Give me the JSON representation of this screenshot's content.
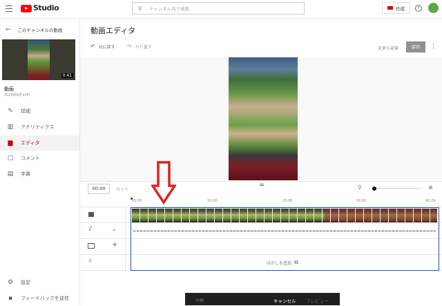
{
  "header": {
    "logo_text": "Studio",
    "search_placeholder": "チャンネル内で検索",
    "create_label": "作成"
  },
  "sidebar": {
    "back_label": "このチャンネルの動画",
    "video_duration": "0:41",
    "video_title": "動画",
    "video_date": "2020年6月14日",
    "items": [
      {
        "label": "詳細",
        "icon": "pencil-icon"
      },
      {
        "label": "アナリティクス",
        "icon": "analytics-icon"
      },
      {
        "label": "エディタ",
        "icon": "editor-icon",
        "active": true
      },
      {
        "label": "コメント",
        "icon": "comment-icon"
      },
      {
        "label": "字幕",
        "icon": "subtitles-icon"
      }
    ],
    "settings_label": "設定",
    "feedback_label": "フィードバックを送信"
  },
  "editor": {
    "title": "動画エディタ",
    "undo_label": "元に戻す",
    "redo_label": "やり直す",
    "discard_label": "変更を破棄",
    "save_label": "保存"
  },
  "timeline": {
    "time_value": "00:00",
    "cut_label": "カット",
    "ticks": [
      "00:00",
      "10:00",
      "20:00",
      "30:00",
      "40:29"
    ],
    "blur_label": "ぼかしを追加"
  },
  "bottom_bar": {
    "split_label": "分割",
    "cancel_label": "キャンセル",
    "preview_label": "プレビュー"
  },
  "colors": {
    "accent": "#cc0000",
    "timeline_border": "#1a56b0",
    "arrow": "#e02020"
  }
}
